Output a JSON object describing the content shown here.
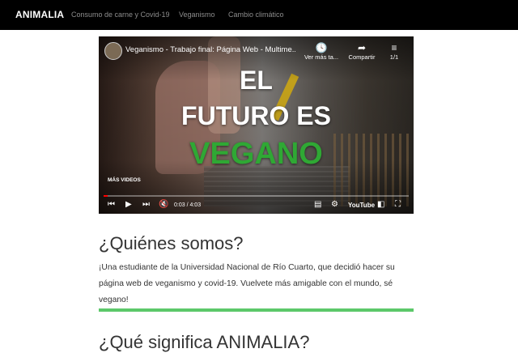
{
  "navbar": {
    "brand": "ANIMALIA",
    "links": [
      "Consumo de carne y Covid-19",
      "Veganismo",
      "Cambio climático"
    ]
  },
  "video": {
    "title": "Veganismo - Trabajo final: Página Web - Multime...",
    "watch_later": "Ver más ta...",
    "share": "Compartir",
    "playlist_count": "1/1",
    "overlay": [
      "EL",
      "FUTURO ES",
      "VEGANO"
    ],
    "more_videos": "MÁS VIDEOS",
    "time": "0:03 / 4:03",
    "progress": 0.012,
    "platform": "YouTube",
    "icons": [
      "clock-icon",
      "share-icon",
      "playlist-icon",
      "skip-back-icon",
      "play-icon",
      "skip-forward-icon",
      "mute-icon",
      "subtitles-icon",
      "gear-icon",
      "cast-icon",
      "fullscreen-icon"
    ]
  },
  "about": {
    "heading": "¿Quiénes somos?",
    "paragraph": "¡Una estudiante de la Universidad Nacional de Río Cuarto, que decidió hacer su página web de veganismo y covid-19. Vuelvete más amigable con el mundo, sé vegano!"
  },
  "meaning": {
    "heading": "¿Qué significa ANIMALIA?"
  },
  "colors": {
    "navbar_bg": "#000000",
    "accent_green": "#5cc86a",
    "overlay_green": "#2fa834"
  }
}
